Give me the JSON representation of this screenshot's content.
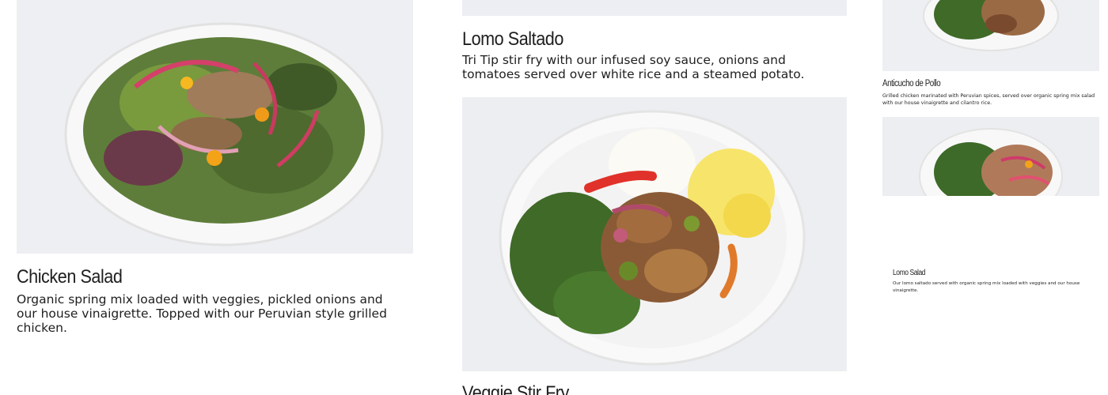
{
  "menu": {
    "chicken_salad": {
      "title": "Chicken Salad",
      "description": "Organic spring mix loaded with veggies, pickled onions and our house vinaigrette. Topped with our Peruvian style grilled chicken."
    },
    "lomo_saltado": {
      "title": "Lomo Saltado",
      "description": "Tri Tip stir fry with our infused soy sauce, onions and tomatoes served over white rice and a steamed potato."
    },
    "veggie_stir_fry": {
      "title": "Veggie Stir Fry"
    },
    "anticucho_de_pollo": {
      "title": "Anticucho de Pollo",
      "description": "Grilled chicken marinated with Peruvian spices, served over organic spring mix salad with our house vinaigrette and cilantro rice."
    },
    "lomo_salad": {
      "title": "Lomo Salad",
      "description": "Our lomo saltado served with organic spring mix loaded with veggies and our house vinaigrette."
    }
  },
  "colors": {
    "background": "#ffffff",
    "text": "#1e1e1e",
    "photo_backdrop": "#eceef2"
  }
}
